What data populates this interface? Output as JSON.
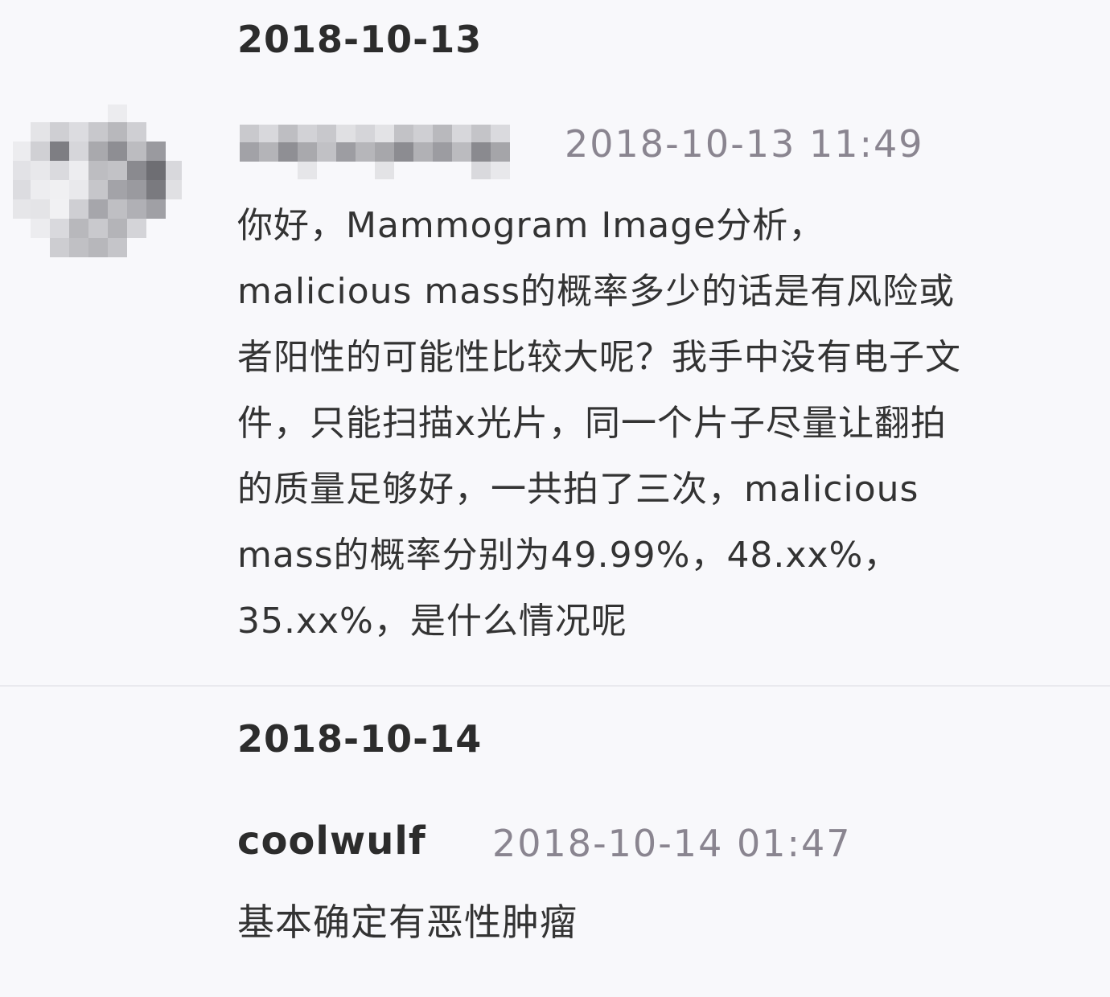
{
  "thread": {
    "day1": {
      "date": "2018-10-13",
      "comment": {
        "timestamp": "2018-10-13 11:49",
        "avatar_icon": "pixelated-avatar-icon",
        "text": "你好，Mammogram Image分析，\nmalicious mass的概率多少的话是有风险或\n者阳性的可能性比较大呢？我手中没有电子文\n件，只能扫描x光片，同一个片子尽量让翻拍\n的质量足够好，一共拍了三次，malicious\nmass的概率分别为49.99%，48.xx%，\n35.xx%，是什么情况呢"
      }
    },
    "day2": {
      "date": "2018-10-14",
      "comment": {
        "username": "coolwulf",
        "timestamp": "2018-10-14 01:47",
        "text": "基本确定有恶性肿瘤"
      }
    }
  },
  "colors": {
    "background": "#f8f8fb",
    "text": "#333333",
    "timestamp": "#8a8590",
    "divider": "#e9e9ee"
  }
}
